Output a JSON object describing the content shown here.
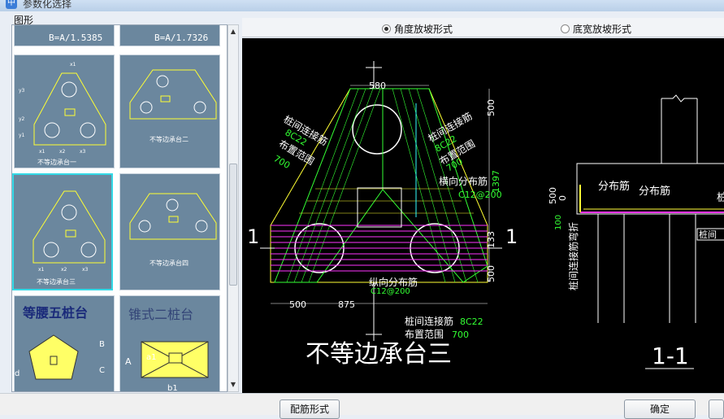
{
  "window": {
    "title": "参数化选择"
  },
  "group_label": "图形",
  "thumbnails": {
    "top_left_formula": "B=A/1.5385",
    "top_right_formula": "B=A/1.7326",
    "items": [
      {
        "caption": "不等边承台一"
      },
      {
        "caption": "不等边承台二"
      },
      {
        "caption": "不等边承台三"
      },
      {
        "caption": "不等边承台四"
      },
      {
        "caption": "等腰五桩台"
      },
      {
        "caption": "锥式二桩台"
      }
    ],
    "selected_index": 2,
    "dim_labels": {
      "x1": "x1",
      "x2": "x2",
      "x3": "x3",
      "y1": "y1",
      "y2": "y2",
      "y3": "y3",
      "a": "a1",
      "b": "b1",
      "A": "A",
      "B": "B",
      "C": "C",
      "d": "d"
    }
  },
  "radios": [
    {
      "label": "角度放坡形式",
      "selected": true
    },
    {
      "label": "底宽放坡形式",
      "selected": false
    }
  ],
  "drawing": {
    "title": "不等边承台三",
    "section_label": "1-1",
    "section_mark": "1",
    "dims": {
      "top_width": "580",
      "left_bottom": "500",
      "mid_bottom": "875",
      "right_500_top": "500",
      "right_1397": "1397",
      "right_133": "133",
      "right_500_bottom": "500",
      "side_500": "500",
      "side_0": "0",
      "side_100": "100"
    },
    "labels": {
      "left_tie": "桩间连接筋",
      "left_tie_spec": "8C22",
      "left_range": "布置范围",
      "left_range_val": "700",
      "right_tie": "桩间连接筋",
      "right_tie_spec": "8C22",
      "right_range": "布置范围",
      "right_range_val": "700",
      "transverse": "横向分布筋",
      "transverse_spec": "C12@200",
      "longitudinal": "纵向分布筋",
      "longitudinal_spec": "C12@200",
      "bottom_tie": "桩间连接筋",
      "bottom_tie_spec": "8C22",
      "bottom_range": "布置范围",
      "bottom_range_val": "700",
      "dist1": "分布筋",
      "dist2": "分布筋",
      "vertical_tie": "桩间连接筋弯折",
      "cut_right": "桩间"
    }
  },
  "buttons": {
    "rebar_form": "配筋形式",
    "ok": "确定"
  },
  "colors": {
    "yellow": "#ffff33",
    "green": "#33ff33",
    "magenta": "#ff33ff",
    "cyan": "#33ffff",
    "white": "#ffffff",
    "thumb_bg": "#6b879e"
  }
}
